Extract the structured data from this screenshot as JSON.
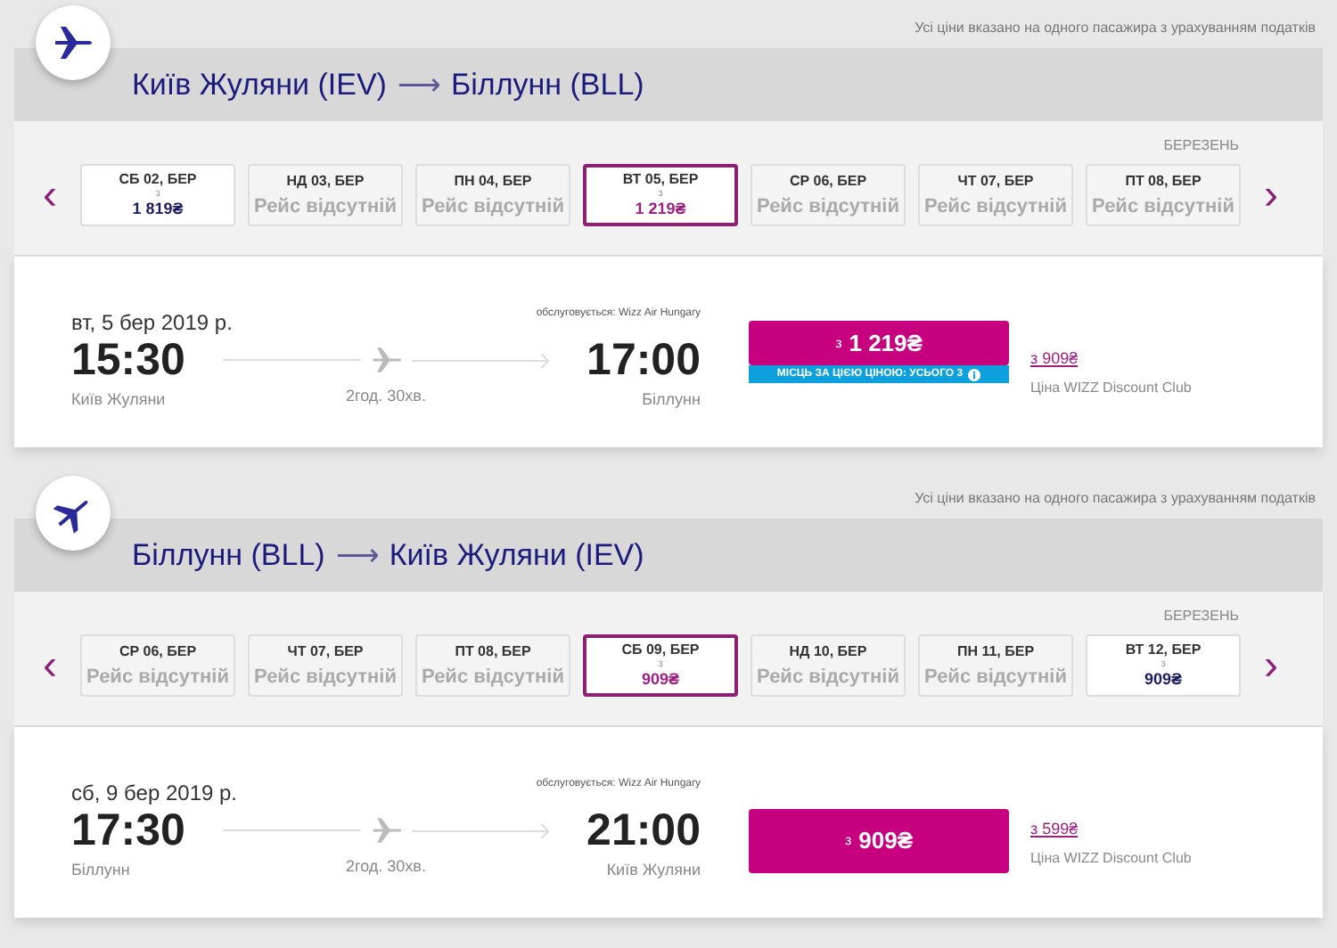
{
  "journeys": [
    {
      "note": "Усі ціни вказано на одного пасажира з урахуванням податків",
      "origin": "Київ Жуляни (IEV)",
      "arrow": "⟶",
      "destination": "Біллунн (BLL)",
      "month": "БЕРЕЗЕНЬ",
      "prev": "‹",
      "next": "›",
      "dates": [
        {
          "day": "СБ 02, БЕР",
          "kind": "price",
          "from": "з",
          "price": "1 819₴",
          "selected": false
        },
        {
          "day": "НД 03, БЕР",
          "kind": "none",
          "status": "Рейс відсутній",
          "selected": false
        },
        {
          "day": "ПН 04, БЕР",
          "kind": "none",
          "status": "Рейс відсутній",
          "selected": false
        },
        {
          "day": "ВТ 05, БЕР",
          "kind": "price",
          "from": "з",
          "price": "1 219₴",
          "selected": true
        },
        {
          "day": "СР 06, БЕР",
          "kind": "none",
          "status": "Рейс відсутній",
          "selected": false
        },
        {
          "day": "ЧТ 07, БЕР",
          "kind": "none",
          "status": "Рейс відсутній",
          "selected": false
        },
        {
          "day": "ПТ 08, БЕР",
          "kind": "none",
          "status": "Рейс відсутній",
          "selected": false
        }
      ],
      "flight": {
        "date": "вт, 5 бер 2019 р.",
        "operator": "обслуговується: Wizz Air Hungary",
        "dep_time": "15:30",
        "dep_city": "Київ Жуляни",
        "duration": "2год. 30хв.",
        "arr_time": "17:00",
        "arr_city": "Біллунн",
        "price_from": "з",
        "price": "1 219₴",
        "seats": "МІСЦЬ ЗА ЦІЄЮ ЦІНОЮ: УСЬОГО 3",
        "club_from": "з",
        "club_price": "909₴",
        "club_label": "Ціна WIZZ Discount Club"
      }
    },
    {
      "note": "Усі ціни вказано на одного пасажира з урахуванням податків",
      "origin": "Біллунн (BLL)",
      "arrow": "⟶",
      "destination": "Київ Жуляни (IEV)",
      "month": "БЕРЕЗЕНЬ",
      "prev": "‹",
      "next": "›",
      "dates": [
        {
          "day": "СР 06, БЕР",
          "kind": "none",
          "status": "Рейс відсутній",
          "selected": false
        },
        {
          "day": "ЧТ 07, БЕР",
          "kind": "none",
          "status": "Рейс відсутній",
          "selected": false
        },
        {
          "day": "ПТ 08, БЕР",
          "kind": "none",
          "status": "Рейс відсутній",
          "selected": false
        },
        {
          "day": "СБ 09, БЕР",
          "kind": "price",
          "from": "з",
          "price": "909₴",
          "selected": true
        },
        {
          "day": "НД 10, БЕР",
          "kind": "none",
          "status": "Рейс відсутній",
          "selected": false
        },
        {
          "day": "ПН 11, БЕР",
          "kind": "none",
          "status": "Рейс відсутній",
          "selected": false
        },
        {
          "day": "ВТ 12, БЕР",
          "kind": "price",
          "from": "з",
          "price": "909₴",
          "selected": false
        }
      ],
      "flight": {
        "date": "сб, 9 бер 2019 р.",
        "operator": "обслуговується: Wizz Air Hungary",
        "dep_time": "17:30",
        "dep_city": "Біллунн",
        "duration": "2год. 30хв.",
        "arr_time": "21:00",
        "arr_city": "Київ Жуляни",
        "price_from": "з",
        "price": "909₴",
        "club_from": "з",
        "club_price": "599₴",
        "club_label": "Ціна WIZZ Discount Club"
      }
    }
  ]
}
